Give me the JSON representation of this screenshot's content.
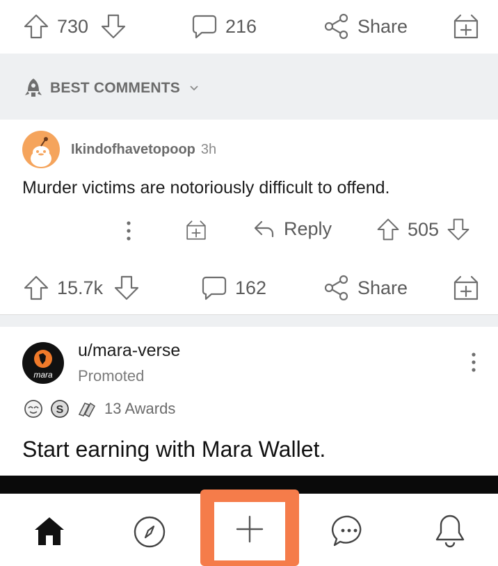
{
  "post_actions": {
    "upvotes": "730",
    "comments": "216",
    "share_label": "Share"
  },
  "sort": {
    "label": "BEST COMMENTS"
  },
  "comment": {
    "username": "Ikindofhavetopoop",
    "age": "3h",
    "body": "Murder victims are notoriously difficult to offend.",
    "reply_label": "Reply",
    "votes": "505",
    "avatar_color": "#f5a45c"
  },
  "post2_actions": {
    "upvotes": "15.7k",
    "comments": "162",
    "share_label": "Share"
  },
  "promoted": {
    "author": "u/mara-verse",
    "promoted_label": "Promoted",
    "logo_text": "mara",
    "awards_label": "13 Awards",
    "title": "Start earning with Mara Wallet."
  },
  "bottom_nav": {
    "items": [
      "home-icon",
      "compass-icon",
      "plus-icon",
      "chat-icon",
      "bell-icon"
    ],
    "highlight_color": "#f57c4a"
  }
}
